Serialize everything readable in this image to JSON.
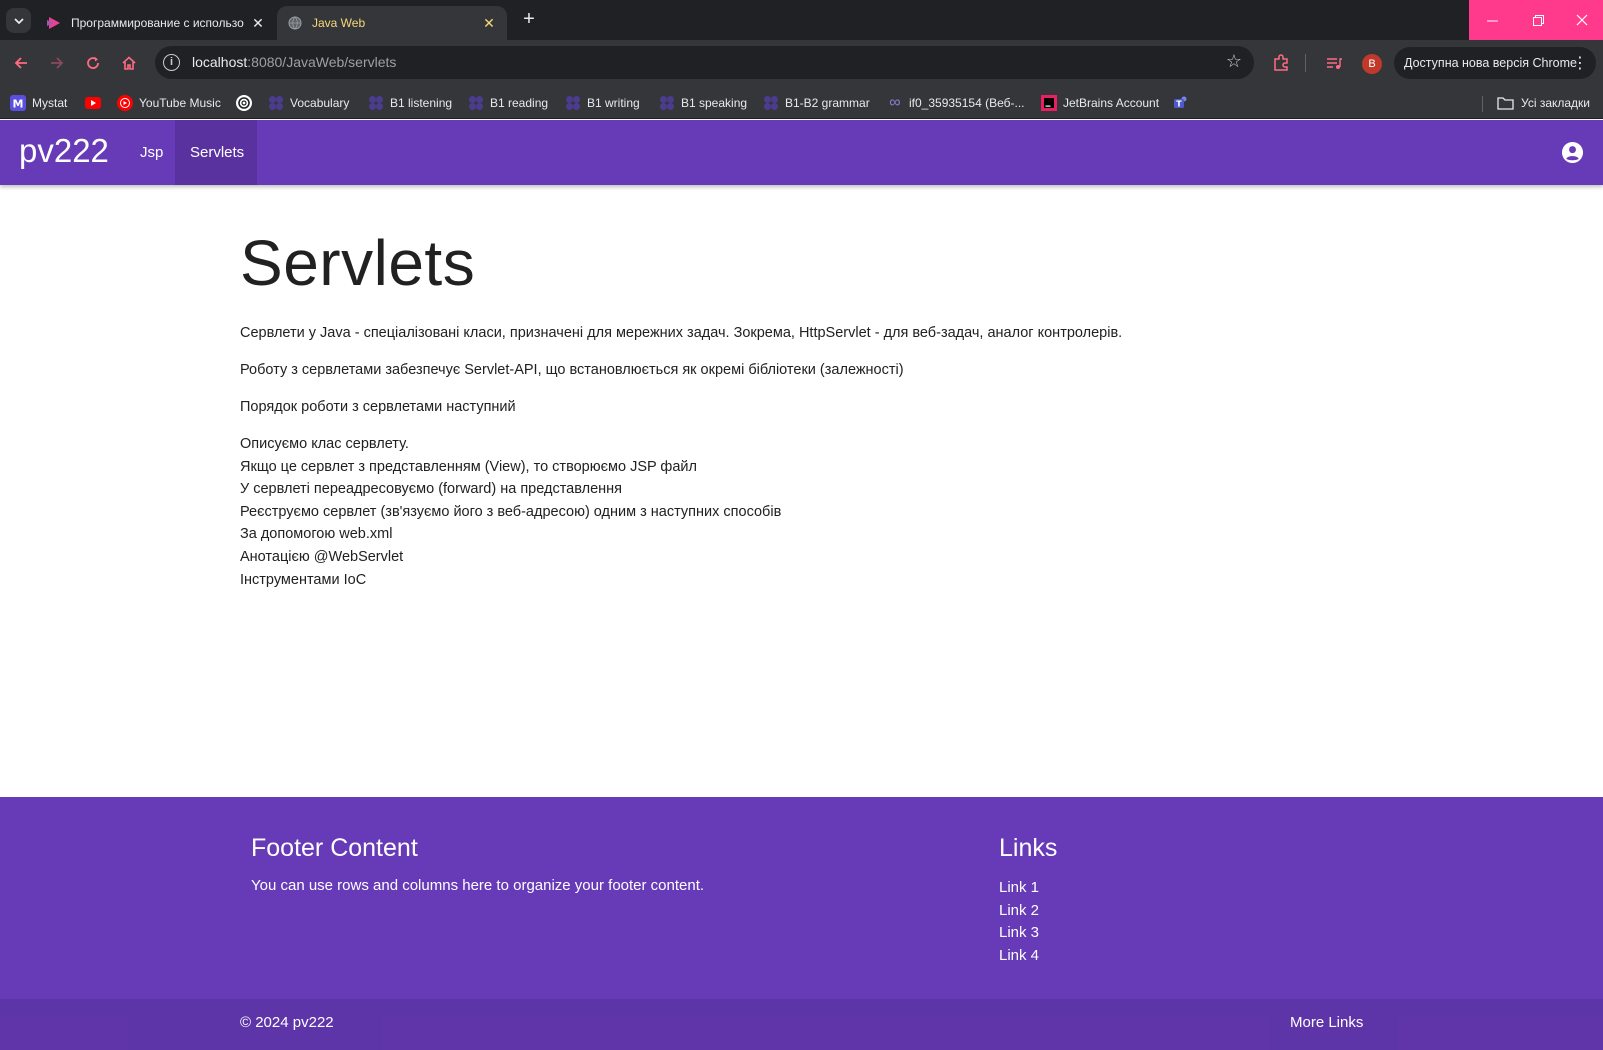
{
  "browser": {
    "tabs": [
      {
        "title": "Программирование с использо",
        "active": false,
        "icon": "studio-play-icon"
      },
      {
        "title": "Java Web",
        "active": true,
        "icon": "globe-icon"
      }
    ],
    "address": {
      "host": "localhost",
      "rest": ":8080/JavaWeb/servlets"
    },
    "profile_initial": "B",
    "update_label": "Доступна нова версія Chrome",
    "bookmarks": [
      {
        "label": "Mystat",
        "icon": "mystat-icon"
      },
      {
        "label": "",
        "icon": "youtube-icon"
      },
      {
        "label": "YouTube Music",
        "icon": "youtube-music-icon"
      },
      {
        "label": "",
        "icon": "chatgpt-icon"
      },
      {
        "label": "Vocabulary",
        "icon": "teams-dots-icon"
      },
      {
        "label": "B1 listening",
        "icon": "teams-dots-icon"
      },
      {
        "label": "B1 reading",
        "icon": "teams-dots-icon"
      },
      {
        "label": "B1 writing",
        "icon": "teams-dots-icon"
      },
      {
        "label": "B1 speaking",
        "icon": "teams-dots-icon"
      },
      {
        "label": "B1-B2 grammar",
        "icon": "teams-dots-icon"
      },
      {
        "label": "if0_35935154 (Веб-...",
        "icon": "infinity-icon"
      },
      {
        "label": "JetBrains Account",
        "icon": "jetbrains-icon"
      },
      {
        "label": "",
        "icon": "teams-icon"
      }
    ],
    "all_bookmarks": "Усі закладки"
  },
  "navbar": {
    "brand": "pv222",
    "items": [
      {
        "label": "Jsp",
        "active": false
      },
      {
        "label": "Servlets",
        "active": true
      }
    ]
  },
  "main": {
    "title": "Servlets",
    "paragraphs": [
      "Сервлети у Java - спеціалізовані класи, призначені для мережних задач. Зокрема, HttpServlet - для веб-задач, аналог контролерів.",
      "Роботу з сервлетами забезпечує Servlet-API, що встановлюється як окремі бібліотеки (залежності)",
      "Порядок роботи з сервлетами наступний"
    ],
    "steps": [
      "Описуємо клас сервлету.",
      "Якщо це сервлет з представленням (View), то створюємо JSP файл",
      "У сервлеті переадресовуємо (forward) на представлення",
      "Реєструємо сервлет (зв'язуємо його з веб-адресою) одним з наступних способів",
      "За допомогою web.xml",
      "Анотацією @WebServlet",
      "Інструментами IoC"
    ]
  },
  "footer": {
    "content_title": "Footer Content",
    "content_text": "You can use rows and columns here to organize your footer content.",
    "links_title": "Links",
    "links": [
      "Link 1",
      "Link 2",
      "Link 3",
      "Link 4"
    ],
    "copyright": "© 2024 pv222",
    "more_links": "More Links"
  },
  "colors": {
    "primary": "#673ab7",
    "tab_active_text": "#f6d87a",
    "window_controls": "#ff3a8c"
  }
}
